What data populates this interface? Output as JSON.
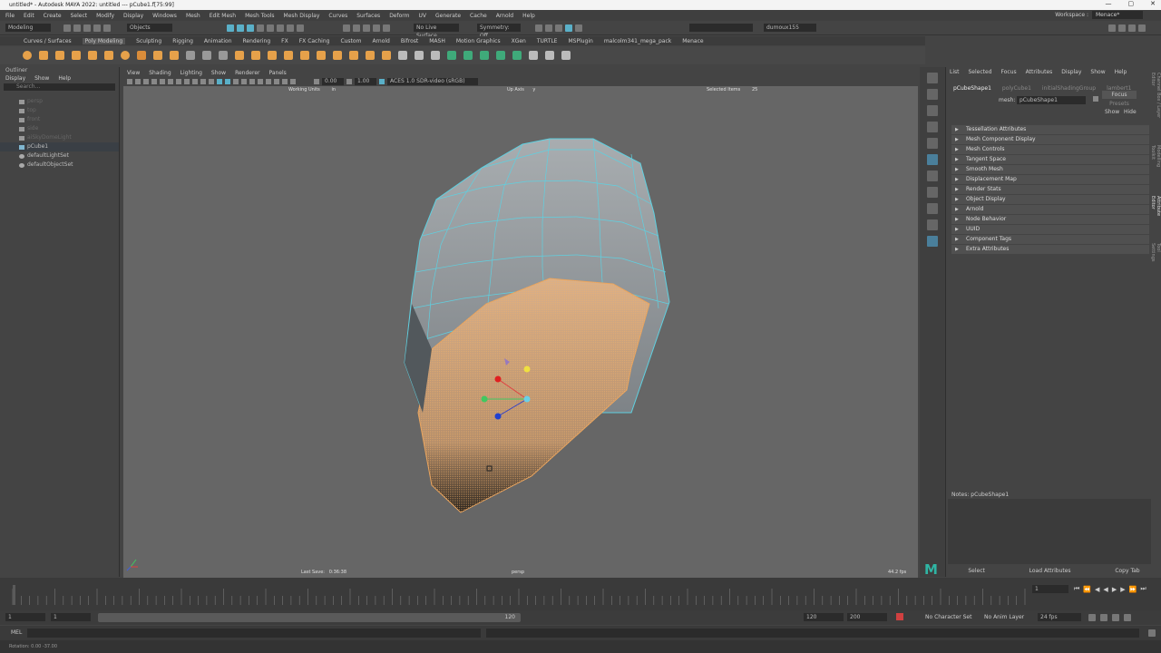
{
  "window": {
    "title": "untitled* - Autodesk MAYA 2022: untitled  ---  pCube1.f[75:99]",
    "controls": [
      "—",
      "▢",
      "✕"
    ]
  },
  "menubar": {
    "items": [
      "File",
      "Edit",
      "Create",
      "Select",
      "Modify",
      "Display",
      "Windows",
      "Mesh",
      "Edit Mesh",
      "Mesh Tools",
      "Mesh Display",
      "Curves",
      "Surfaces",
      "Deform",
      "UV",
      "Generate",
      "Cache",
      "Arnold",
      "Help"
    ],
    "workspace_label": "Workspace :",
    "workspace_value": "Menace*"
  },
  "statusline": {
    "mode": "Modeling",
    "objects_field": "Objects",
    "live_surface": "No Live Surface",
    "symmetry": "Symmetry: Off",
    "user": "dumoux155"
  },
  "shelf": {
    "tabs": [
      "Curves / Surfaces",
      "Poly Modeling",
      "Sculpting",
      "Rigging",
      "Animation",
      "Rendering",
      "FX",
      "FX Caching",
      "Custom",
      "Arnold",
      "Bifrost",
      "MASH",
      "Motion Graphics",
      "XGen",
      "TURTLE",
      "MSPlugin",
      "malcolm341_mega_pack",
      "Menace"
    ],
    "active_tab": "Poly Modeling"
  },
  "outliner": {
    "title": "Outliner",
    "menu": [
      "Display",
      "Show",
      "Help"
    ],
    "search_placeholder": "Search...",
    "items": [
      {
        "label": "persp",
        "dim": true
      },
      {
        "label": "top",
        "dim": true
      },
      {
        "label": "front",
        "dim": true
      },
      {
        "label": "side",
        "dim": true
      },
      {
        "label": "aiSkyDomeLight",
        "dim": true
      },
      {
        "label": "pCube1",
        "dim": false,
        "selected": true
      },
      {
        "label": "defaultLightSet",
        "dim": false
      },
      {
        "label": "defaultObjectSet",
        "dim": false
      }
    ]
  },
  "viewport": {
    "menu": [
      "View",
      "Shading",
      "Lighting",
      "Show",
      "Renderer",
      "Panels"
    ],
    "exposure": "0.00",
    "gamma": "1.00",
    "color_space": "ACES 1.0 SDR-video (sRGB)",
    "hud": {
      "working_units_label": "Working Units",
      "working_units_value": "in",
      "up_axis_label": "Up Axis",
      "up_axis_value": "y",
      "selected_items_label": "Selected Items",
      "selected_items_value": "25",
      "last_save_label": "Last Save:",
      "last_save_value": "0:36:38",
      "camera": "persp",
      "fps": "44.2 fps"
    }
  },
  "attribute_editor": {
    "menu": [
      "List",
      "Selected",
      "Focus",
      "Attributes",
      "Display",
      "Show",
      "Help"
    ],
    "tabs": [
      "pCubeShape1",
      "polyCube1",
      "initialShadingGroup",
      "lambert1"
    ],
    "node_label": "mesh:",
    "node_value": "pCubeShape1",
    "focus": "Focus",
    "presets": "Presets",
    "show": "Show",
    "hide": "Hide",
    "sections": [
      "Tessellation Attributes",
      "Mesh Component Display",
      "Mesh Controls",
      "Tangent Space",
      "Smooth Mesh",
      "Displacement Map",
      "Render Stats",
      "Object Display",
      "Arnold",
      "Node Behavior",
      "UUID",
      "Component Tags",
      "Extra Attributes"
    ],
    "notes_label": "Notes: pCubeShape1",
    "buttons": [
      "Select",
      "Load Attributes",
      "Copy Tab"
    ]
  },
  "right_tabs": [
    "Channel Box / Layer Editor",
    "Modelling Toolkit",
    "Attribute Editor",
    "Tool Settings"
  ],
  "timeline": {
    "current_frame": "1",
    "range_start": "1",
    "range_start_inner": "1",
    "range_end_inner": "120",
    "range_end": "120",
    "anim_end": "200",
    "character_set": "No Character Set",
    "anim_layer": "No Anim Layer",
    "fps": "24 fps"
  },
  "command_line": {
    "label": "MEL"
  },
  "help_line": {
    "text": "Rotation:    0.00     -37.00"
  },
  "logo": "M",
  "colors": {
    "wire": "#5fd0e0",
    "selection": "#e9a45e",
    "accent": "#4a7f9b"
  }
}
